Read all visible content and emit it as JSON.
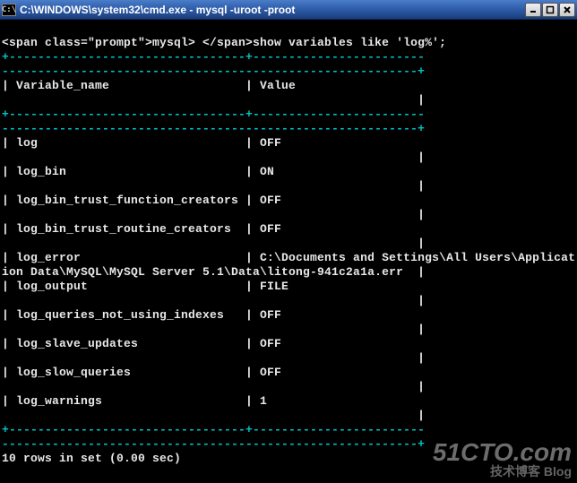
{
  "titlebar": {
    "icon_label": "C:\\",
    "title": "C:\\WINDOWS\\system32\\cmd.exe - mysql -uroot -proot"
  },
  "prompt": "mysql> ",
  "query": "show variables like 'log%';",
  "columns": {
    "name": "Variable_name",
    "value": "Value"
  },
  "rows": [
    {
      "name": "log",
      "value": "OFF"
    },
    {
      "name": "log_bin",
      "value": "ON"
    },
    {
      "name": "log_bin_trust_function_creators",
      "value": "OFF"
    },
    {
      "name": "log_bin_trust_routine_creators",
      "value": "OFF"
    },
    {
      "name": "log_error",
      "value": "C:\\Documents and Settings\\All Users\\Application Data\\MySQL\\MySQL Server 5.1\\Data\\litong-941c2a1a.err"
    },
    {
      "name": "log_output",
      "value": "FILE"
    },
    {
      "name": "log_queries_not_using_indexes",
      "value": "OFF"
    },
    {
      "name": "log_slave_updates",
      "value": "OFF"
    },
    {
      "name": "log_slow_queries",
      "value": "OFF"
    },
    {
      "name": "log_warnings",
      "value": "1"
    }
  ],
  "summary": "10 rows in set (0.00 sec)",
  "watermark": {
    "big": "51CTO.com",
    "sub": "技术博客  Blog"
  }
}
